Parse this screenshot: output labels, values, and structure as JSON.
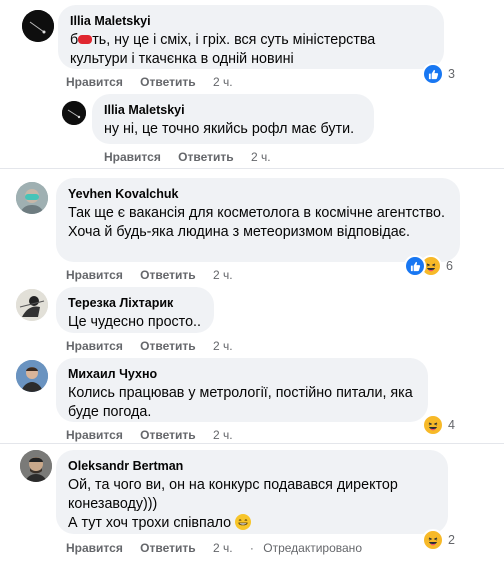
{
  "labels": {
    "like": "Нравится",
    "reply": "Ответить"
  },
  "colors": {
    "like": "#1877f2",
    "haha": "#f7b928",
    "bubble": "#f0f2f5",
    "meta": "#65676b"
  },
  "comments": [
    {
      "author": "Illia Maletskyi",
      "text_prefix": "б",
      "text": "ть, ну це і сміх, і гріх. вся суть міністерства культури і ткачєнка в одній новині",
      "time": "2 ч.",
      "reactions": [
        "like-icon"
      ],
      "reaction_count": "3"
    },
    {
      "author": "Illia Maletskyi",
      "text": "ну ні, це точно якийсь рофл має бути.",
      "time": "2 ч.",
      "reply": true
    },
    {
      "author": "Yevhen Kovalchuk",
      "text": "Так ще є вакансія для косметолога в космічне агентство. Хоча й будь-яка людина з метеоризмом відповідає.",
      "time": "2 ч.",
      "reactions": [
        "like-icon",
        "haha-icon"
      ],
      "reaction_count": "6"
    },
    {
      "author": "Терезка Ліхтарик",
      "text": "Це чудесно просто..",
      "time": "2 ч."
    },
    {
      "author": "Михаил Чухно",
      "text": "Колись працював у метрології, постійно питали, яка буде погода.",
      "time": "2 ч.",
      "reactions": [
        "haha-icon"
      ],
      "reaction_count": "4"
    },
    {
      "author": "Oleksandr Bertman",
      "text": "Ой, та чого ви, он на конкурс подавався директор конезаводу)))",
      "text2": "А тут хоч трохи співпало",
      "time": "2 ч.",
      "edited": "Отредактировано",
      "reactions": [
        "haha-icon"
      ],
      "reaction_count": "2"
    }
  ]
}
